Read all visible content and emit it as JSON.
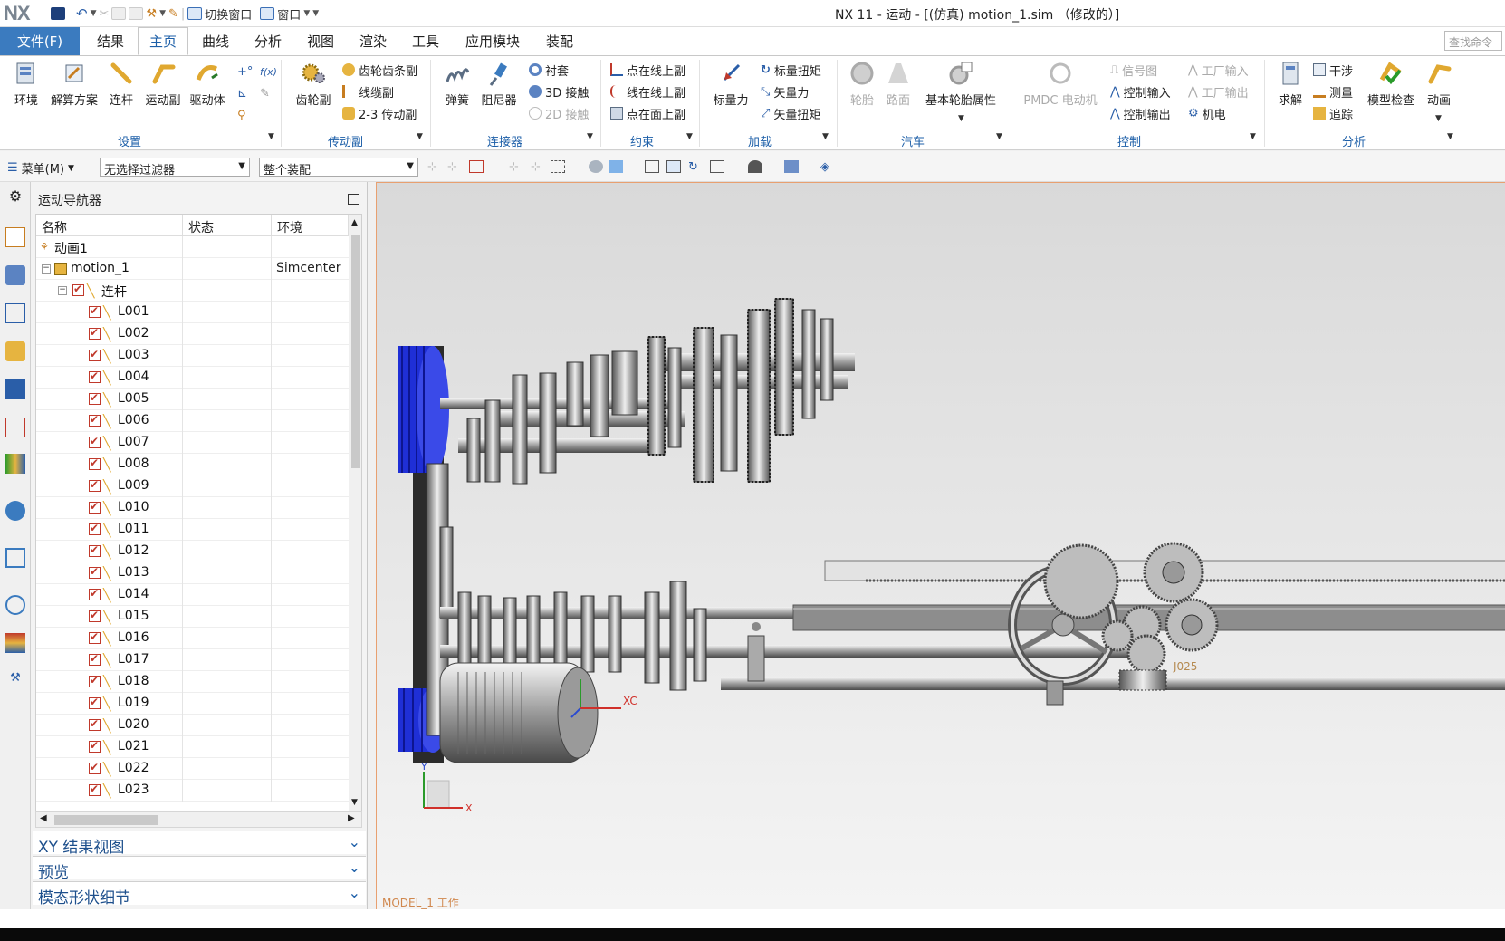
{
  "titlebar": {
    "logo": "NX",
    "switch_window": "切换窗口",
    "window": "窗口",
    "title": "NX 11 - 运动 - [(仿真) motion_1.sim （修改的）]"
  },
  "tabs": {
    "file": "文件(F)",
    "items": [
      "结果",
      "主页",
      "曲线",
      "分析",
      "视图",
      "渲染",
      "工具",
      "应用模块",
      "装配"
    ],
    "active": "主页",
    "search_placeholder": "查找命令"
  },
  "ribbon": {
    "setup": {
      "group": "设置",
      "env": "环境",
      "solution": "解算方案",
      "link": "连杆",
      "motion_pair": "运动副",
      "driver": "驱动体"
    },
    "transmission": {
      "group": "传动副",
      "gear": "齿轮副",
      "rack": "齿轮齿条副",
      "cable": "线缆副",
      "two_three": "2-3 传动副"
    },
    "connector": {
      "group": "连接器",
      "spring": "弹簧",
      "damper": "阻尼器",
      "bushing": "衬套",
      "contact3d": "3D 接触",
      "contact2d": "2D 接触"
    },
    "constraint": {
      "group": "约束",
      "pt_curve": "点在线上副",
      "curve_curve": "线在线上副",
      "pt_surface": "点在面上副"
    },
    "load": {
      "group": "加载",
      "scalar_force": "标量力",
      "scalar_torque": "标量扭矩",
      "vector_force": "矢量力",
      "vector_torque": "矢量扭矩"
    },
    "auto": {
      "group": "汽车",
      "tire": "轮胎",
      "road": "路面",
      "tire_props": "基本轮胎属性"
    },
    "control": {
      "group": "控制",
      "pmdc": "PMDC 电动机",
      "signal_chart": "信号图",
      "ctrl_in": "控制输入",
      "ctrl_out": "控制输出",
      "plant_in": "工厂输入",
      "plant_out": "工厂输出",
      "mechatronics": "机电"
    },
    "analysis": {
      "group": "分析",
      "solve": "求解",
      "interference": "干涉",
      "measure": "测量",
      "trace": "追踪",
      "model_check": "模型检查",
      "animation": "动画"
    }
  },
  "toolbar": {
    "menu": "菜单(M)",
    "filter": "无选择过滤器",
    "scope": "整个装配"
  },
  "navigator": {
    "title": "运动导航器",
    "columns": [
      "名称",
      "状态",
      "环境"
    ],
    "root_anim": "动画1",
    "motion": {
      "name": "motion_1",
      "env": "Simcenter"
    },
    "links_folder": "连杆",
    "links": [
      "L001",
      "L002",
      "L003",
      "L004",
      "L005",
      "L006",
      "L007",
      "L008",
      "L009",
      "L010",
      "L011",
      "L012",
      "L013",
      "L014",
      "L015",
      "L016",
      "L017",
      "L018",
      "L019",
      "L020",
      "L021",
      "L022",
      "L023"
    ],
    "sections": [
      "XY 结果视图",
      "预览",
      "模态形状细节"
    ]
  },
  "graphics": {
    "model_label": "MODEL_1 工作",
    "joint_label": "J025",
    "csys_xc": "XC",
    "axis_x": "X",
    "axis_y": "Y"
  },
  "colors": {
    "accent": "#3b7bbf",
    "tab_active": "#1d5fa8",
    "pulley_blue": "#1f2fd6"
  }
}
